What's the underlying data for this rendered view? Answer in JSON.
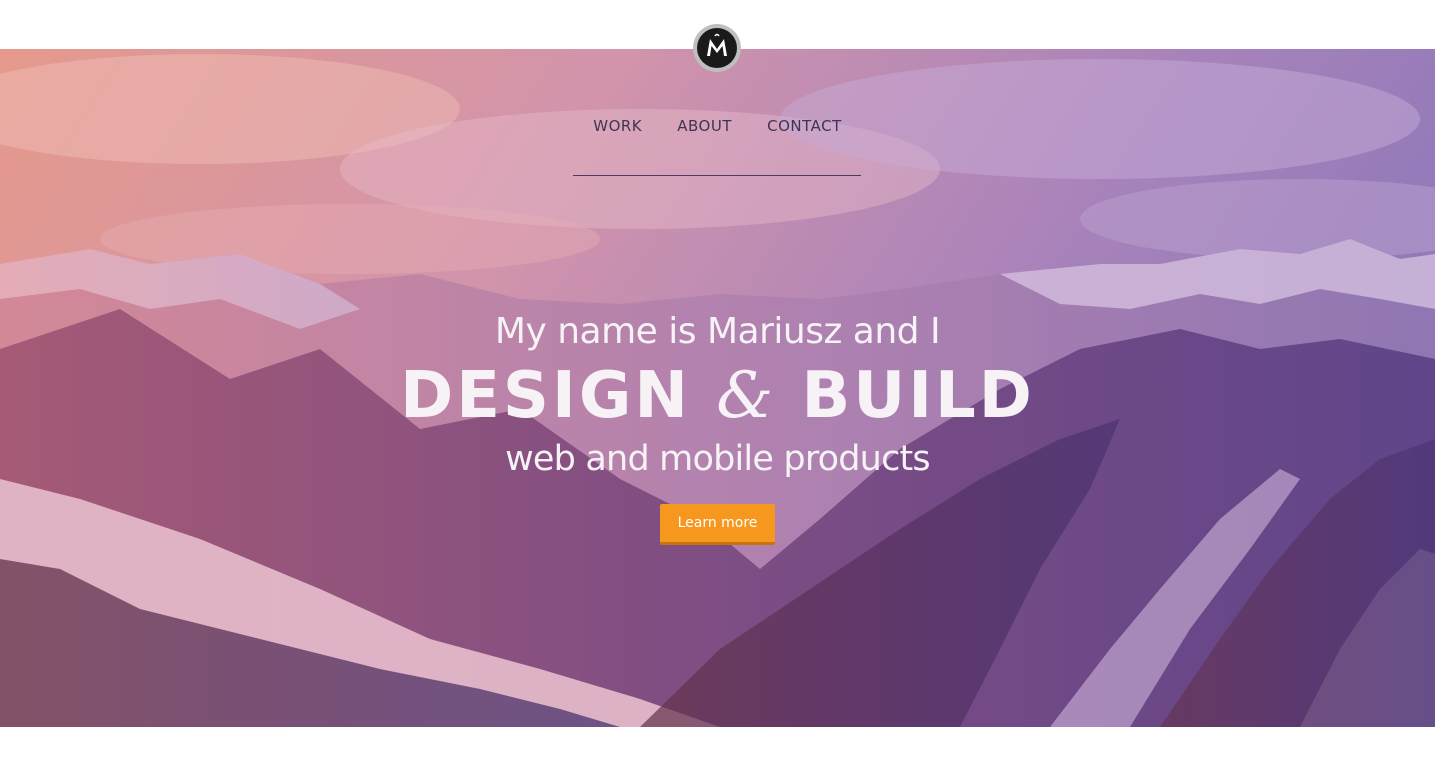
{
  "brand": {
    "logo_icon": "m-monogram-icon"
  },
  "nav": {
    "items": [
      {
        "label": "WORK"
      },
      {
        "label": "ABOUT"
      },
      {
        "label": "CONTACT"
      }
    ]
  },
  "hero": {
    "line1": "My name is Mariusz and I",
    "line2_left": "DESIGN",
    "line2_amp": "&",
    "line2_right": "BUILD",
    "line3": "web and mobile products",
    "cta_label": "Learn more"
  },
  "colors": {
    "accent": "#f5981d",
    "nav_text": "#3f3552",
    "hero_gradient_start": "#e89a84",
    "hero_gradient_end": "#7d66b0"
  }
}
